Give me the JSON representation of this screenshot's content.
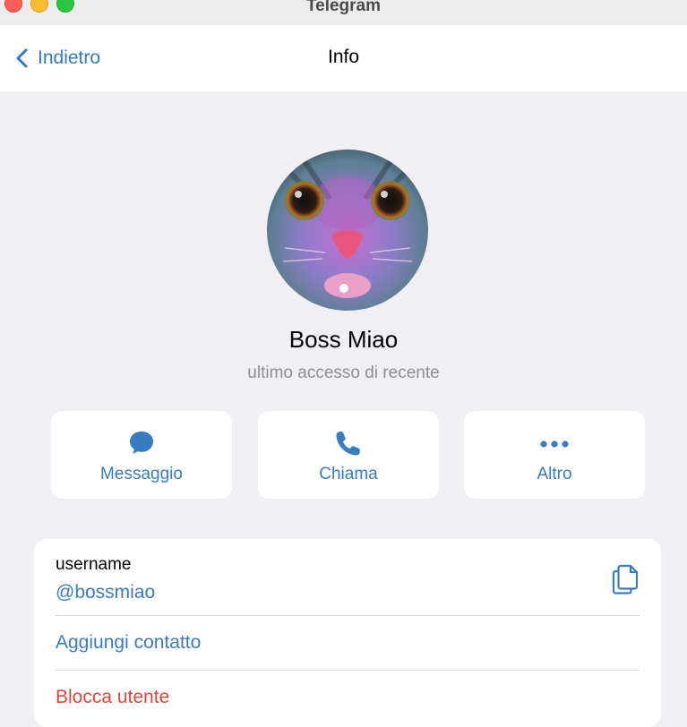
{
  "window": {
    "title": "Telegram"
  },
  "nav": {
    "back_label": "Indietro",
    "title": "Info"
  },
  "profile": {
    "name": "Boss Miao",
    "status": "ultimo accesso di recente"
  },
  "actions": [
    {
      "label": "Messaggio",
      "icon": "message-bubble-icon"
    },
    {
      "label": "Chiama",
      "icon": "phone-icon"
    },
    {
      "label": "Altro",
      "icon": "more-dots-icon"
    }
  ],
  "details": {
    "username_label": "username",
    "username_value": "@bossmiao",
    "add_contact": "Aggiungi contatto",
    "block_user": "Blocca utente"
  },
  "colors": {
    "accent": "#3a7cc2",
    "destructive": "#e0453c",
    "background": "#efeff4"
  }
}
